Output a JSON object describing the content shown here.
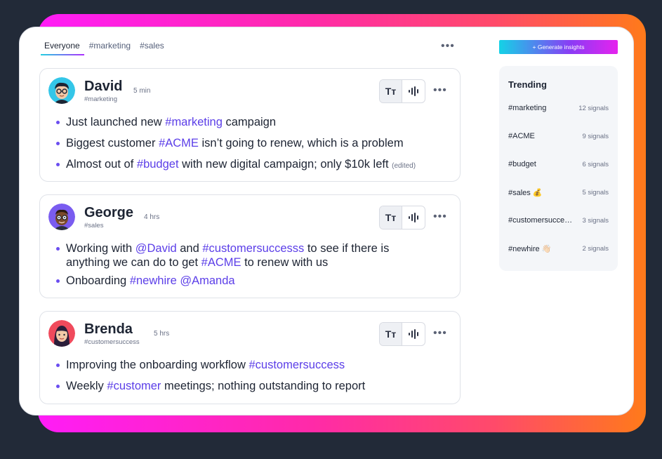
{
  "tabs": [
    {
      "label": "Everyone",
      "active": true
    },
    {
      "label": "#marketing",
      "active": false
    },
    {
      "label": "#sales",
      "active": false
    }
  ],
  "generate_button": {
    "label": "+ Generate insights"
  },
  "posts": [
    {
      "name": "David",
      "channel": "#marketing",
      "time": "5 min",
      "bullets": [
        [
          {
            "t": "Just launched new "
          },
          {
            "t": "#marketing",
            "tag": true
          },
          {
            "t": " campaign"
          }
        ],
        [
          {
            "t": "Biggest customer "
          },
          {
            "t": "#ACME",
            "tag": true
          },
          {
            "t": " isn’t going to renew, which is a problem"
          }
        ],
        [
          {
            "t": "Almost out of "
          },
          {
            "t": "#budget",
            "tag": true
          },
          {
            "t": " with new digital campaign; only $10k left "
          },
          {
            "t": "(edited)",
            "edited": true
          }
        ]
      ]
    },
    {
      "name": "George",
      "channel": "#sales",
      "time": "4 hrs",
      "bullets": [
        [
          {
            "t": "Working with "
          },
          {
            "t": "@David",
            "tag": true
          },
          {
            "t": " and "
          },
          {
            "t": "#customersuccesss",
            "tag": true
          },
          {
            "t": " to see if there is anything we can do to get "
          },
          {
            "t": "#ACME",
            "tag": true
          },
          {
            "t": " to renew with us"
          }
        ],
        [
          {
            "t": "Onboarding "
          },
          {
            "t": "#newhire @Amanda",
            "tag": true
          }
        ]
      ]
    },
    {
      "name": "Brenda",
      "channel": "#customersuccess",
      "time": "5 hrs",
      "bullets": [
        [
          {
            "t": "Improving the onboarding workflow "
          },
          {
            "t": "#customersuccess",
            "tag": true
          }
        ],
        [
          {
            "t": "Weekly "
          },
          {
            "t": "#customer",
            "tag": true
          },
          {
            "t": " meetings; nothing outstanding to report"
          }
        ]
      ]
    }
  ],
  "post_buttons": {
    "text_button": "Tт"
  },
  "trending": {
    "title": "Trending",
    "items": [
      {
        "tag": "#marketing",
        "count": "12 signals"
      },
      {
        "tag": "#ACME",
        "count": "9 signals"
      },
      {
        "tag": "#budget",
        "count": "6 signals"
      },
      {
        "tag": "#sales 💰",
        "count": "5 signals"
      },
      {
        "tag": "#customersucce…",
        "count": "3 signals"
      },
      {
        "tag": "#newhire 👋🏻",
        "count": "2 signals"
      }
    ]
  },
  "colors": {
    "accent": "#5b3ee8",
    "bullet": "#6a4df0",
    "frame_start": "#ff1cf7",
    "frame_end": "#ff7a1a"
  }
}
